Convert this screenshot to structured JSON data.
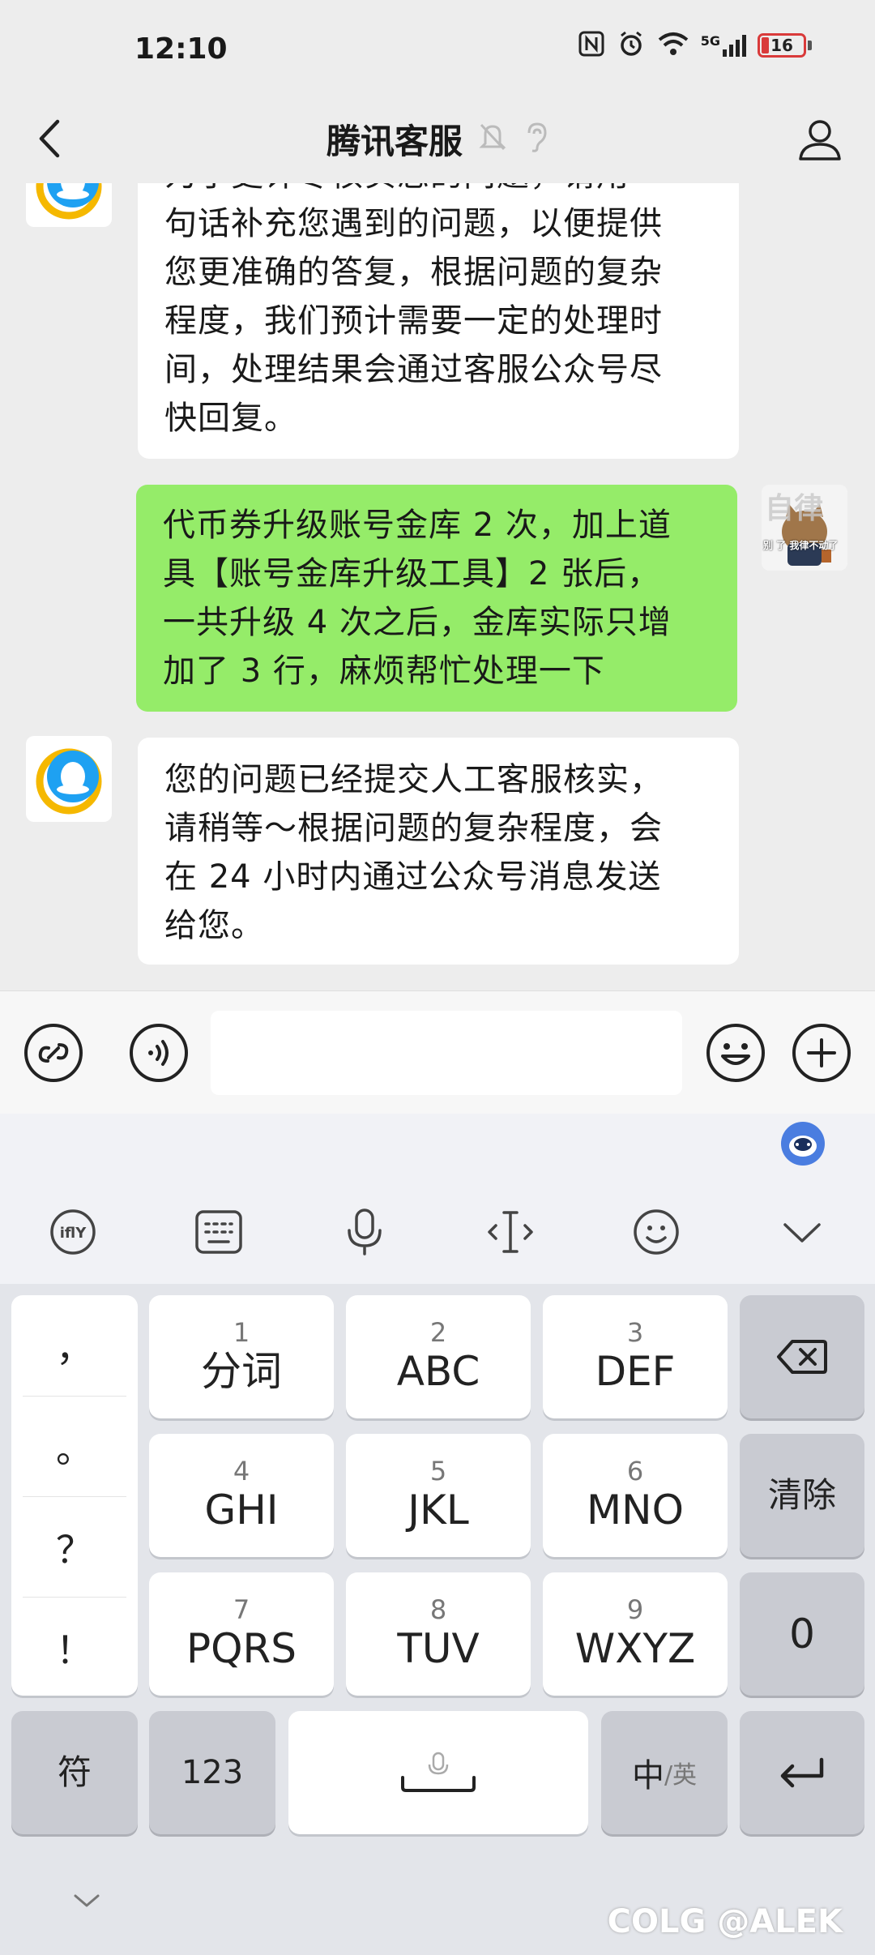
{
  "status_bar": {
    "time": "12:10",
    "network": "5G",
    "battery": "16"
  },
  "header": {
    "title": "腾讯客服"
  },
  "messages": [
    {
      "side": "in",
      "text": "为了更详尽核实您的问题，请用\n句话补充您遇到的问题，以便提供\n您更准确的答复，根据问题的复杂\n程度，我们预计需要一定的处理时\n间，处理结果会通过客服公众号尽\n快回复。"
    },
    {
      "side": "out",
      "text": "代币券升级账号金库 2 次，加上道\n具【账号金库升级工具】2 张后，\n一共升级 4 次之后，金库实际只增\n加了 3 行，麻烦帮忙处理一下"
    },
    {
      "side": "in",
      "text": "您的问题已经提交人工客服核实，\n请稍等～根据问题的复杂程度，会\n在 24 小时内通过公众号消息发送\n给您。"
    }
  ],
  "user_avatar": {
    "top_text": "自律",
    "bottom_text": "别 了 我律不动了"
  },
  "input": {
    "placeholder": "",
    "value": ""
  },
  "keyboard": {
    "punctuation": [
      "，",
      "。",
      "？",
      "！"
    ],
    "rows": [
      [
        {
          "num": "1",
          "label": "分词"
        },
        {
          "num": "2",
          "label": "ABC"
        },
        {
          "num": "3",
          "label": "DEF"
        }
      ],
      [
        {
          "num": "4",
          "label": "GHI"
        },
        {
          "num": "5",
          "label": "JKL"
        },
        {
          "num": "6",
          "label": "MNO"
        }
      ],
      [
        {
          "num": "7",
          "label": "PQRS"
        },
        {
          "num": "8",
          "label": "TUV"
        },
        {
          "num": "9",
          "label": "WXYZ"
        }
      ]
    ],
    "clear": "清除",
    "zero": "0",
    "symbols": "符",
    "numbers": "123",
    "lang_cn": "中",
    "lang_sep": "/英"
  },
  "watermark": "COLG @ALEK",
  "colors": {
    "sent_bubble": "#95ec69",
    "received_bubble": "#ffffff",
    "background": "#ededed"
  }
}
